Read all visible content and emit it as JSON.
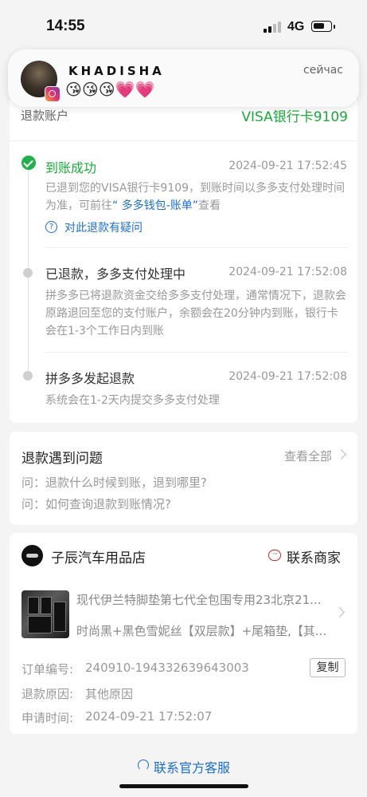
{
  "status_bar": {
    "time": "14:55",
    "network": "4G"
  },
  "notification": {
    "sender": "KHADISHA",
    "message": "😘😘😘💗💗",
    "time": "сейчас",
    "app_icon": "instagram-icon"
  },
  "refund_account": {
    "label": "退款账户",
    "value": "VISA银行卡9109"
  },
  "timeline": [
    {
      "title": "到账成功",
      "time": "2024-09-21 17:52:45",
      "desc_prefix": "已退到您的VISA银行卡9109，到账时间以多多支付处理时间为准，可前往",
      "desc_link": "“ 多多钱包-账单”",
      "desc_suffix": "查看",
      "help_link": "对此退款有疑问"
    },
    {
      "title": "已退款，多多支付处理中",
      "time": "2024-09-21 17:52:08",
      "desc": "拼多多已将退款资金交给多多支付处理，通常情况下，退款会原路退回至您的支付账户，余额会在20分钟内到账，银行卡会在1-3个工作日内到账"
    },
    {
      "title": "拼多多发起退款",
      "time": "2024-09-21 17:52:08",
      "desc": "系统会在1-2天内提交多多支付处理"
    }
  ],
  "problems": {
    "title": "退款遇到问题",
    "view_all": "查看全部",
    "questions": [
      "问：退款什么时候到账，退到哪里?",
      "问：如何查询退款到账情况?"
    ]
  },
  "shop": {
    "name": "子辰汽车用品店",
    "contact": "联系商家",
    "product_title": "现代伊兰特脚垫第七代全包围专用23北京21...",
    "product_spec": "时尚黑+黑色雪妮丝【双层款】+尾箱垫,【其..."
  },
  "order_info": [
    {
      "label": "订单编号:",
      "value": "240910-194332639643003"
    },
    {
      "label": "退款原因:",
      "value": "其他原因"
    },
    {
      "label": "申请时间:",
      "value": "2024-09-21 17:52:07"
    }
  ],
  "copy_label": "复制",
  "footer": {
    "customer_service": "联系官方客服"
  },
  "colors": {
    "success": "#1aac3a",
    "link": "#1c6fd1",
    "contact": "#e0221f"
  }
}
